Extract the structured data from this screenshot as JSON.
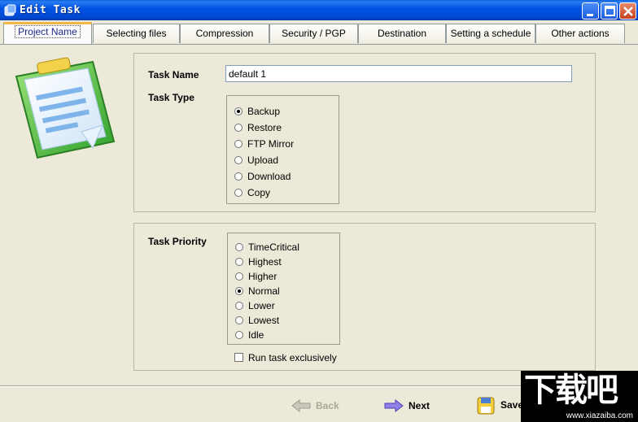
{
  "window": {
    "title": "Edit Task"
  },
  "tabs": [
    {
      "label": "Project Name",
      "active": true
    },
    {
      "label": "Selecting files",
      "active": false
    },
    {
      "label": "Compression",
      "active": false
    },
    {
      "label": "Security / PGP",
      "active": false
    },
    {
      "label": "Destination",
      "active": false
    },
    {
      "label": "Setting a schedule",
      "active": false
    },
    {
      "label": "Other actions",
      "active": false
    }
  ],
  "task": {
    "name_label": "Task Name",
    "name_value": "default 1",
    "type_label": "Task Type",
    "types": [
      {
        "label": "Backup",
        "selected": true
      },
      {
        "label": "Restore",
        "selected": false
      },
      {
        "label": "FTP Mirror",
        "selected": false
      },
      {
        "label": "Upload",
        "selected": false
      },
      {
        "label": "Download",
        "selected": false
      },
      {
        "label": "Copy",
        "selected": false
      }
    ],
    "priority_label": "Task Priority",
    "priorities": [
      {
        "label": "TimeCritical",
        "selected": false
      },
      {
        "label": "Highest",
        "selected": false
      },
      {
        "label": "Higher",
        "selected": false
      },
      {
        "label": "Normal",
        "selected": true
      },
      {
        "label": "Lower",
        "selected": false
      },
      {
        "label": "Lowest",
        "selected": false
      },
      {
        "label": "Idle",
        "selected": false
      }
    ],
    "exclusive_label": "Run task exclusively",
    "exclusive_checked": false
  },
  "buttons": {
    "back": "Back",
    "next": "Next",
    "save": "Save"
  },
  "watermark": {
    "big": "下载吧",
    "small": "www.xiazaiba.com"
  },
  "colors": {
    "titlebar": "#0055e5",
    "tab_active_accent": "#f5b74b",
    "dialog_bg": "#ece9d8"
  }
}
